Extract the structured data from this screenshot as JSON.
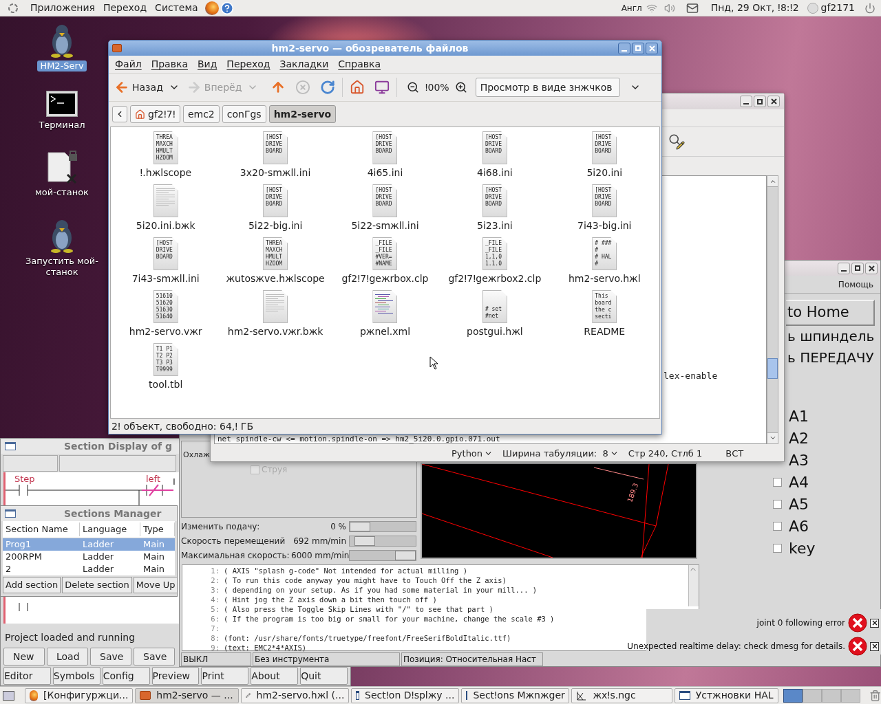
{
  "top_panel": {
    "menus": [
      "Приложения",
      "Переход",
      "Система"
    ],
    "keyboard_layout": "Англ",
    "clock": "Пнд, 29 Окт, ǃ8:ǃ2",
    "user": "gf2171"
  },
  "desktop_icons": [
    {
      "kind": "penguin",
      "label": "HM2-Serv",
      "selected": true
    },
    {
      "kind": "terminal",
      "label": "Терминал",
      "selected": false
    },
    {
      "kind": "file",
      "label": "мой-станок",
      "selected": false
    },
    {
      "kind": "penguin",
      "label": "Запустить мой-станок",
      "selected": false
    }
  ],
  "file_manager": {
    "title": "hm2-servo — обозреватель файлов",
    "menu": [
      "Файл",
      "Правка",
      "Вид",
      "Переход",
      "Закладки",
      "Справка"
    ],
    "back": "Назад",
    "forward": "Вперёд",
    "zoom": "ǃ00%",
    "view_mode": "Просмотр в виде знжчков",
    "path": [
      {
        "label": "gf2ǃ7ǃ",
        "selected": false,
        "kind": "home"
      },
      {
        "label": "emc2",
        "selected": false,
        "kind": "plain"
      },
      {
        "label": "conГgs",
        "selected": false,
        "kind": "plain"
      },
      {
        "label": "hm2-servo",
        "selected": true,
        "kind": "plain"
      }
    ],
    "files": [
      {
        "name": "ǃ.hжlscope",
        "kind": "text",
        "preview": [
          "THREA",
          "MAXCH",
          "HMULT",
          "HZOOM"
        ]
      },
      {
        "name": "3x20-smжll.ini",
        "kind": "text",
        "preview": [
          "[HOST",
          "DRIVE",
          "BOARD"
        ]
      },
      {
        "name": "4i65.ini",
        "kind": "text",
        "preview": [
          "[HOST",
          "DRIVE",
          "BOARD"
        ]
      },
      {
        "name": "4i68.ini",
        "kind": "text",
        "preview": [
          "[HOST",
          "DRIVE",
          "BOARD"
        ]
      },
      {
        "name": "5i20.ini",
        "kind": "text",
        "preview": [
          "[HOST",
          "DRIVE",
          "BOARD"
        ]
      },
      {
        "name": "5i20.ini.bжk",
        "kind": "blank"
      },
      {
        "name": "5i22-big.ini",
        "kind": "text",
        "preview": [
          "[HOST",
          "DRIVE",
          "BOARD"
        ]
      },
      {
        "name": "5i22-smжll.ini",
        "kind": "text",
        "preview": [
          "[HOST",
          "DRIVE",
          "BOARD"
        ]
      },
      {
        "name": "5i23.ini",
        "kind": "text",
        "preview": [
          "[HOST",
          "DRIVE",
          "BOARD"
        ]
      },
      {
        "name": "7i43-big.ini",
        "kind": "text",
        "preview": [
          "[HOST",
          "DRIVE",
          "BOARD"
        ]
      },
      {
        "name": "7i43-smжll.ini",
        "kind": "text",
        "preview": [
          "[HOST",
          "DRIVE",
          "BOARD"
        ]
      },
      {
        "name": "жutosжve.hжlscope",
        "kind": "text",
        "preview": [
          "THREA",
          "MAXCH",
          "HMULT",
          "HZOOM"
        ]
      },
      {
        "name": "gf2ǃ7ǃgeжrbox.clp",
        "kind": "text",
        "preview": [
          "_FILE",
          "_FILE",
          "#VER=",
          "#NAME"
        ]
      },
      {
        "name": "gf2ǃ7ǃgeжrbox2.clp",
        "kind": "text",
        "preview": [
          "_FILE",
          "_FILE",
          "1,1,0",
          "1.1.0"
        ]
      },
      {
        "name": "hm2-servo.hжl",
        "kind": "text",
        "preview": [
          "# ###",
          "#",
          "# HAL",
          "#"
        ]
      },
      {
        "name": "hm2-servo.vжr",
        "kind": "text",
        "preview": [
          "51610",
          "51620",
          "51630",
          "51640"
        ]
      },
      {
        "name": "hm2-servo.vжr.bжk",
        "kind": "blank"
      },
      {
        "name": "pжnel.xml",
        "kind": "xml"
      },
      {
        "name": "postgui.hжl",
        "kind": "text_low",
        "preview": [
          "# set",
          "#net"
        ]
      },
      {
        "name": "README",
        "kind": "text",
        "preview": [
          "This",
          "board",
          "the c",
          "secti"
        ]
      },
      {
        "name": "tool.tbl",
        "kind": "text",
        "preview": [
          "T1 P1",
          "T2 P2",
          "T3 P3",
          "T9999"
        ]
      }
    ],
    "status": "2ǃ объект, свободно: 64,ǃ ГБ"
  },
  "text_editor": {
    "lines": [
      "lex-enable",
      "net spindle-cw <= motion.spindle-on => hm2_5i20.0.gpio.071.out"
    ],
    "status_bar": {
      "language": "Python",
      "tab_width": "Ширина табуляции:  8",
      "position": "Стр 240, Стлб 1",
      "mode": "ВСТ"
    }
  },
  "axis": {
    "menu": [
      "Помощь"
    ],
    "home_button": "to Home",
    "manual_labels": [
      "ь шпиндель",
      "ь ПЕРЕДАЧУ"
    ],
    "coolant_label": "Охлаж",
    "coolant_options": [
      {
        "label": "Струя",
        "checked": false,
        "disabled": true
      }
    ],
    "sliders": [
      {
        "label": "Изменить подачу:",
        "reading": "0 %",
        "level": 0
      },
      {
        "label": "Скорость перемещений",
        "reading": "692 mm/min",
        "level": 0.1
      },
      {
        "label": "Максимальная скорость:",
        "reading": "6000 mm/min",
        "level": 1
      }
    ],
    "preview_labels": [
      "189.3"
    ],
    "gcode": [
      {
        "number": "1:",
        "text": "( AXIS \"splash g-code\" Not intended for actual milling )"
      },
      {
        "number": "2:",
        "text": "( To run this code anyway you might have to Touch Off the Z axis)"
      },
      {
        "number": "3:",
        "text": "( depending on your setup. As if you had some material in your mill... )"
      },
      {
        "number": "4:",
        "text": "( Hint jog the Z axis down a bit then touch off )"
      },
      {
        "number": "5:",
        "text": "( Also press the Toggle Skip Lines with \"/\" to see that part )"
      },
      {
        "number": "6:",
        "text": "( If the program is too big or small for your machine, change the scale #3 )"
      },
      {
        "number": "7:"
      },
      {
        "number": "8:",
        "text": "(font: /usr/share/fonts/truetype/freefont/FreeSerifBoldItalic.ttf)"
      },
      {
        "number": "9:",
        "text": "(text: EMC2*4*AXIS)"
      }
    ],
    "status_bar": [
      "ВЫКЛ",
      "Без инструмента",
      "Позиция: Относительная Наст"
    ],
    "io_items": [
      {
        "label": "A1"
      },
      {
        "label": "A2"
      },
      {
        "label": "A3"
      },
      {
        "label": "A4",
        "checked": false
      },
      {
        "label": "A5",
        "checked": false
      },
      {
        "label": "A6",
        "checked": false
      },
      {
        "label": "key",
        "checked": false
      }
    ],
    "notifications": [
      "joint 0 following error",
      "Unexpected realtime delay: check dmesg for details."
    ]
  },
  "ladder": {
    "title": "Section Display of g",
    "rung_labels": [
      "Step",
      "left",
      "I"
    ],
    "status": "Project loaded and running",
    "button_rows": [
      [
        "New",
        "Load",
        "Save",
        "Save"
      ],
      [
        "Editor",
        "Symbols",
        "Config",
        "Preview",
        "Print",
        "About",
        "Quit"
      ]
    ]
  },
  "sections_manager": {
    "title": "Sections Manager",
    "columns": [
      "Section Name",
      "Language",
      "Type"
    ],
    "rows": [
      {
        "cells": [
          "Prog1",
          "Ladder",
          "Main"
        ],
        "selected": true
      },
      {
        "cells": [
          "200RPM",
          "Ladder",
          "Main"
        ],
        "selected": false
      },
      {
        "cells": [
          "2",
          "Ladder",
          "Main"
        ],
        "selected": false
      }
    ],
    "buttons": [
      "Add section",
      "Delete section",
      "Move Up"
    ]
  },
  "taskbar": [
    {
      "kind": "browser",
      "label": "[Конфигуржци..."
    },
    {
      "kind": "folder",
      "label": "hm2-servo — ..."
    },
    {
      "kind": "editor",
      "label": "hm2-servo.hжl (..."
    },
    {
      "kind": "window",
      "label": "Sectǃon Dǃsplжy ..."
    },
    {
      "kind": "window",
      "label": "Sectǃons Mжnжger"
    },
    {
      "kind": "axis",
      "label": "жxǃs.ngc"
    },
    {
      "kind": "window",
      "label": "Устжновки HAL"
    }
  ]
}
